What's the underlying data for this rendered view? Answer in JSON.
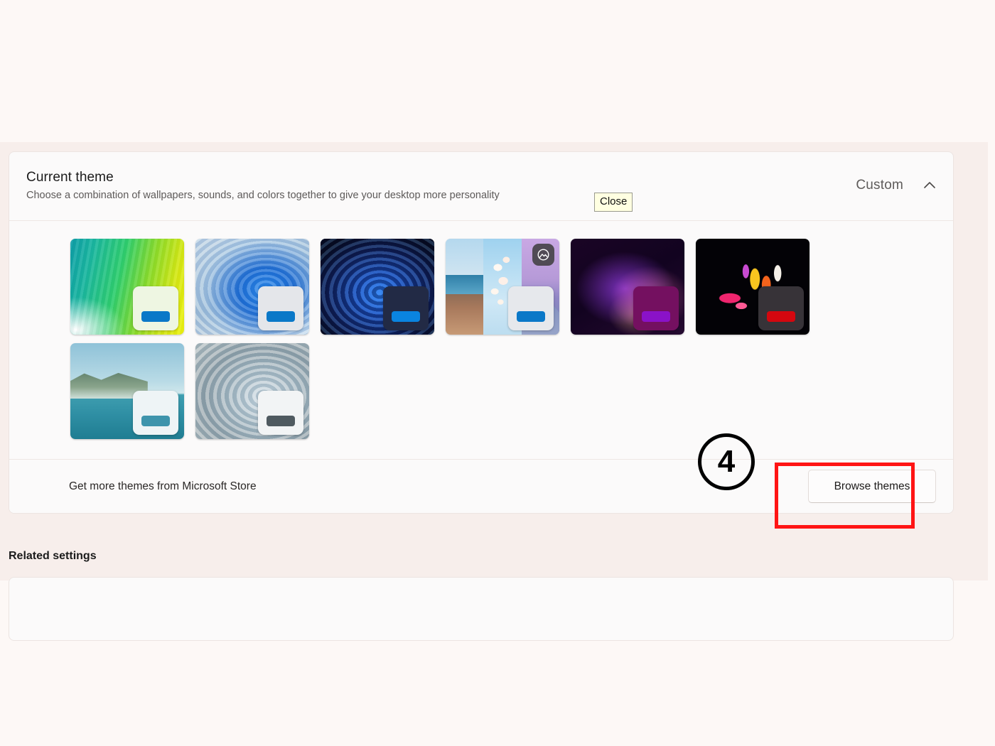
{
  "page": {
    "background_top": "#fdf8f6",
    "background_band": "#f7eeeb"
  },
  "theme_card": {
    "title": "Current theme",
    "description": "Choose a combination of wallpapers, sounds, and colors together to give your desktop more personality",
    "selected_value": "Custom",
    "expand_icon": "chevron-up-icon",
    "thumbnails": [
      {
        "name": "Windows (light) spectrum green theme",
        "accent": "#0a78c8",
        "window_tone": "light"
      },
      {
        "name": "Windows 11 bloom light theme",
        "accent": "#0a78c8",
        "window_tone": "light"
      },
      {
        "name": "Windows 11 bloom dark theme",
        "accent": "#0a84e0",
        "window_tone": "dark"
      },
      {
        "name": "Slideshow theme",
        "accent": "#0a78c8",
        "window_tone": "light",
        "badge": "slideshow-icon"
      },
      {
        "name": "Aurora purple dark theme",
        "accent": "#8a12c8",
        "window_tone": "dark"
      },
      {
        "name": "Flower petals dark theme",
        "accent": "#d4070f",
        "window_tone": "dark"
      },
      {
        "name": "Lake reflection theme",
        "accent": "#3e94ac",
        "window_tone": "light"
      },
      {
        "name": "Wave light theme",
        "accent": "#4f5a60",
        "window_tone": "light"
      }
    ],
    "footer": {
      "store_label": "Get more themes from Microsoft Store",
      "browse_button": "Browse themes"
    }
  },
  "related": {
    "heading": "Related settings"
  },
  "tooltip": {
    "text": "Close"
  },
  "annotations": {
    "step_number": "4",
    "highlight_color": "#ff1414",
    "highlight_target": "browse-themes-button"
  }
}
